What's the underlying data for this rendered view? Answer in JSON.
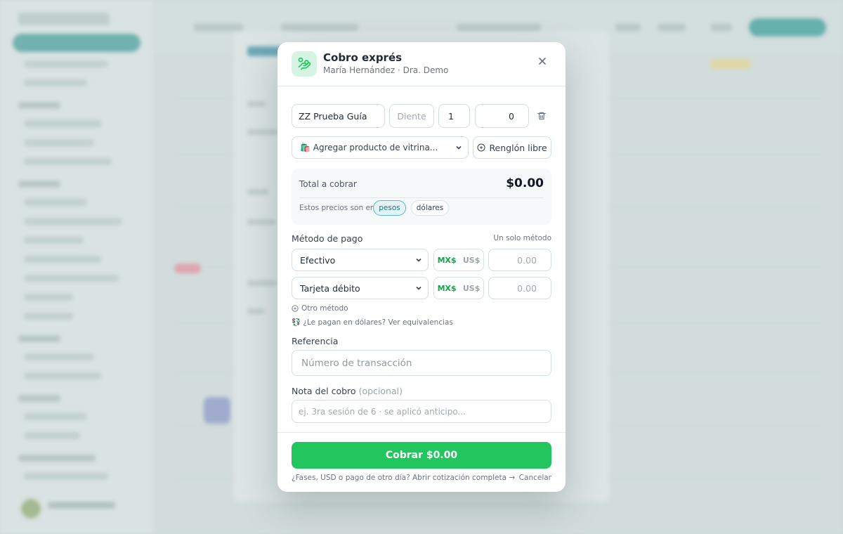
{
  "modal": {
    "title": "Cobro exprés",
    "subtitle": "María Hernández · Dra. Demo",
    "line_item": {
      "product_value": "ZZ Prueba Guía",
      "tooth_placeholder": "Diente",
      "quantity_value": "1",
      "price_value": "0"
    },
    "add_product_label": "🛍️ Agregar producto de vitrina...",
    "free_row_label": "Renglón libre",
    "total": {
      "label": "Total a cobrar",
      "value": "$0.00",
      "prices_label": "Estos precios son en",
      "currency_options": [
        "pesos",
        "dólares"
      ],
      "selected_currency": "pesos"
    },
    "payment": {
      "label": "Método de pago",
      "mode_label": "Un solo método",
      "rows": [
        {
          "method": "Efectivo",
          "mx_label": "MX$",
          "us_label": "US$",
          "amount_placeholder": "0.00"
        },
        {
          "method": "Tarjeta débito",
          "mx_label": "MX$",
          "us_label": "US$",
          "amount_placeholder": "0.00"
        }
      ],
      "other_method_label": "Otro método",
      "usd_help_label": "💱 ¿Le pagan en dólares? Ver equivalencias"
    },
    "reference": {
      "label": "Referencia",
      "placeholder": "Número de transacción"
    },
    "note": {
      "label": "Nota del cobro",
      "optional_label": "(opcional)",
      "placeholder": "ej. 3ra sesión de 6 · se aplicó anticipo..."
    },
    "footer": {
      "pay_button": "Cobrar $0.00",
      "full_quote_link": "¿Fases, USD o pago de otro día? Abrir cotización completa →",
      "cancel_label": "Cancelar"
    }
  },
  "colors": {
    "accent_green": "#22c55e",
    "accent_teal": "#5bb8c0",
    "border": "#cfe0df"
  }
}
